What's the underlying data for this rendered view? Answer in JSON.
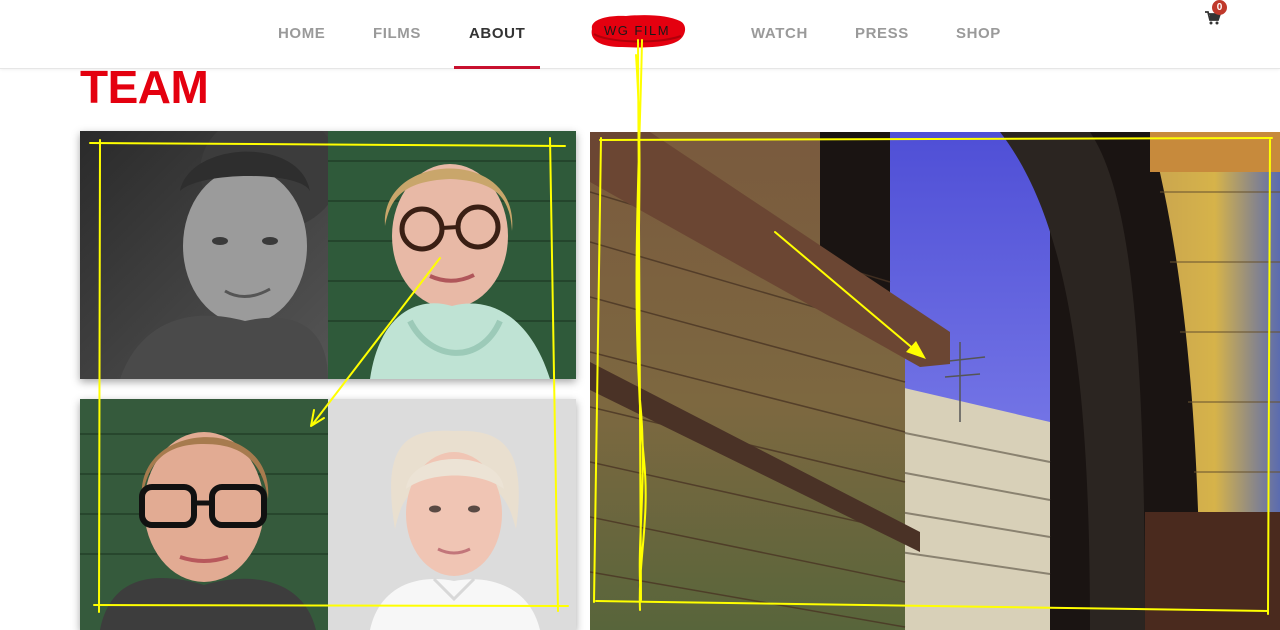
{
  "nav": {
    "items": [
      {
        "label": "HOME",
        "active": false
      },
      {
        "label": "FILMS",
        "active": false
      },
      {
        "label": "ABOUT",
        "active": true
      },
      {
        "label": "WATCH",
        "active": false
      },
      {
        "label": "PRESS",
        "active": false
      },
      {
        "label": "SHOP",
        "active": false
      }
    ],
    "logo_text": "WG FILM",
    "cart_count": "0"
  },
  "page": {
    "title": "TEAM"
  },
  "colors": {
    "accent_red": "#e4000f",
    "nav_inactive": "#9a9a9a",
    "nav_active": "#333333",
    "annotation_yellow": "#ffff00",
    "badge_red": "#c0392b"
  },
  "icons": [
    "cart-icon",
    "logo-blob"
  ]
}
